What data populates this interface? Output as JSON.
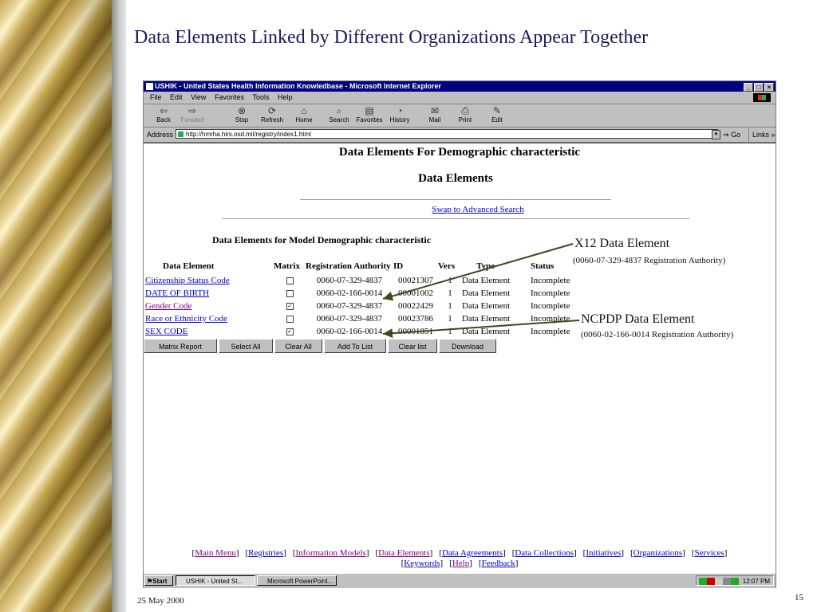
{
  "slide": {
    "title": "Data Elements Linked by Different Organizations Appear Together",
    "date": "25 May 2000",
    "page_number": "15"
  },
  "browser": {
    "window_title": "USHIK - United States Health Information Knowledbase - Microsoft Internet Explorer",
    "window_controls": [
      "_",
      "□",
      "×"
    ],
    "menu": [
      "File",
      "Edit",
      "View",
      "Favorites",
      "Tools",
      "Help"
    ],
    "toolbar": [
      {
        "label": "Back",
        "icon": "back-arrow-icon",
        "glyph": "⇦",
        "enabled": true
      },
      {
        "label": "Forward",
        "icon": "forward-arrow-icon",
        "glyph": "⇨",
        "enabled": false
      },
      {
        "label": "Stop",
        "icon": "stop-icon",
        "glyph": "⊗",
        "enabled": true
      },
      {
        "label": "Refresh",
        "icon": "refresh-icon",
        "glyph": "⟳",
        "enabled": true
      },
      {
        "label": "Home",
        "icon": "home-icon",
        "glyph": "⌂",
        "enabled": true
      },
      {
        "label": "Search",
        "icon": "search-icon",
        "glyph": "⌕",
        "enabled": true
      },
      {
        "label": "Favorites",
        "icon": "favorites-icon",
        "glyph": "▤",
        "enabled": true
      },
      {
        "label": "History",
        "icon": "history-icon",
        "glyph": "◔",
        "enabled": true
      },
      {
        "label": "Mail",
        "icon": "mail-icon",
        "glyph": "✉",
        "enabled": true
      },
      {
        "label": "Print",
        "icon": "print-icon",
        "glyph": "⎙",
        "enabled": true
      },
      {
        "label": "Edit",
        "icon": "edit-icon",
        "glyph": "✎",
        "enabled": true
      }
    ],
    "address_label": "Address",
    "address_url": "http://hmrha.hirs.osd.mil/registry/index1.html",
    "go_label": "Go",
    "links_label": "Links »"
  },
  "page": {
    "heading": "Data Elements For Demographic characteristic",
    "section_heading": "Data Elements",
    "swap_link": "Swap to Advanced Search",
    "model_heading": "Data Elements for Model Demographic characteristic",
    "table": {
      "headers": [
        "Data Element",
        "Matrix",
        "Registration Authority",
        "ID",
        "Vers",
        "Type",
        "Status"
      ],
      "rows": [
        {
          "name": "Citizenship Status Code",
          "matrix": false,
          "reg": "0060-07-329-4837",
          "id": "00021307",
          "vers": "1",
          "type": "Data Element",
          "status": "Incomplete",
          "visited": false
        },
        {
          "name": "DATE OF BIRTH",
          "matrix": false,
          "reg": "0060-02-166-0014",
          "id": "00001002",
          "vers": "1",
          "type": "Data Element",
          "status": "Incomplete",
          "visited": false
        },
        {
          "name": "Gender Code",
          "matrix": true,
          "reg": "0060-07-329-4837",
          "id": "00022429",
          "vers": "1",
          "type": "Data Element",
          "status": "Incomplete",
          "visited": true
        },
        {
          "name": "Race or Ethnicity Code",
          "matrix": false,
          "reg": "0060-07-329-4837",
          "id": "00023786",
          "vers": "1",
          "type": "Data Element",
          "status": "Incomplete",
          "visited": false
        },
        {
          "name": "SEX CODE",
          "matrix": true,
          "reg": "0060-02-166-0014",
          "id": "00001851",
          "vers": "1",
          "type": "Data Element",
          "status": "Incomplete",
          "visited": false
        }
      ]
    },
    "buttons": [
      "Matrix Report",
      "Select All",
      "Clear All",
      "Add To List",
      "Clear list",
      "Download"
    ],
    "bottom_nav_row1": [
      "Main Menu",
      "Registries",
      "Information Models",
      "Data Elements",
      "Data Agreements",
      "Data Collections",
      "Initiatives",
      "Organizations",
      "Services"
    ],
    "bottom_nav_row2": [
      "Keywords",
      "Help",
      "Feedback"
    ]
  },
  "taskbar": {
    "start": "Start",
    "tasks": [
      "USHIK - United St...",
      "Microsoft PowerPoint..."
    ],
    "clock": "12:07 PM"
  },
  "callouts": {
    "x12_title": "X12 Data Element",
    "x12_sub": "(0060-07-329-4837 Registration Authority)",
    "ncpdp_title": "NCPDP Data Element",
    "ncpdp_sub": "(0060-02-166-0014 Registration Authority)"
  }
}
